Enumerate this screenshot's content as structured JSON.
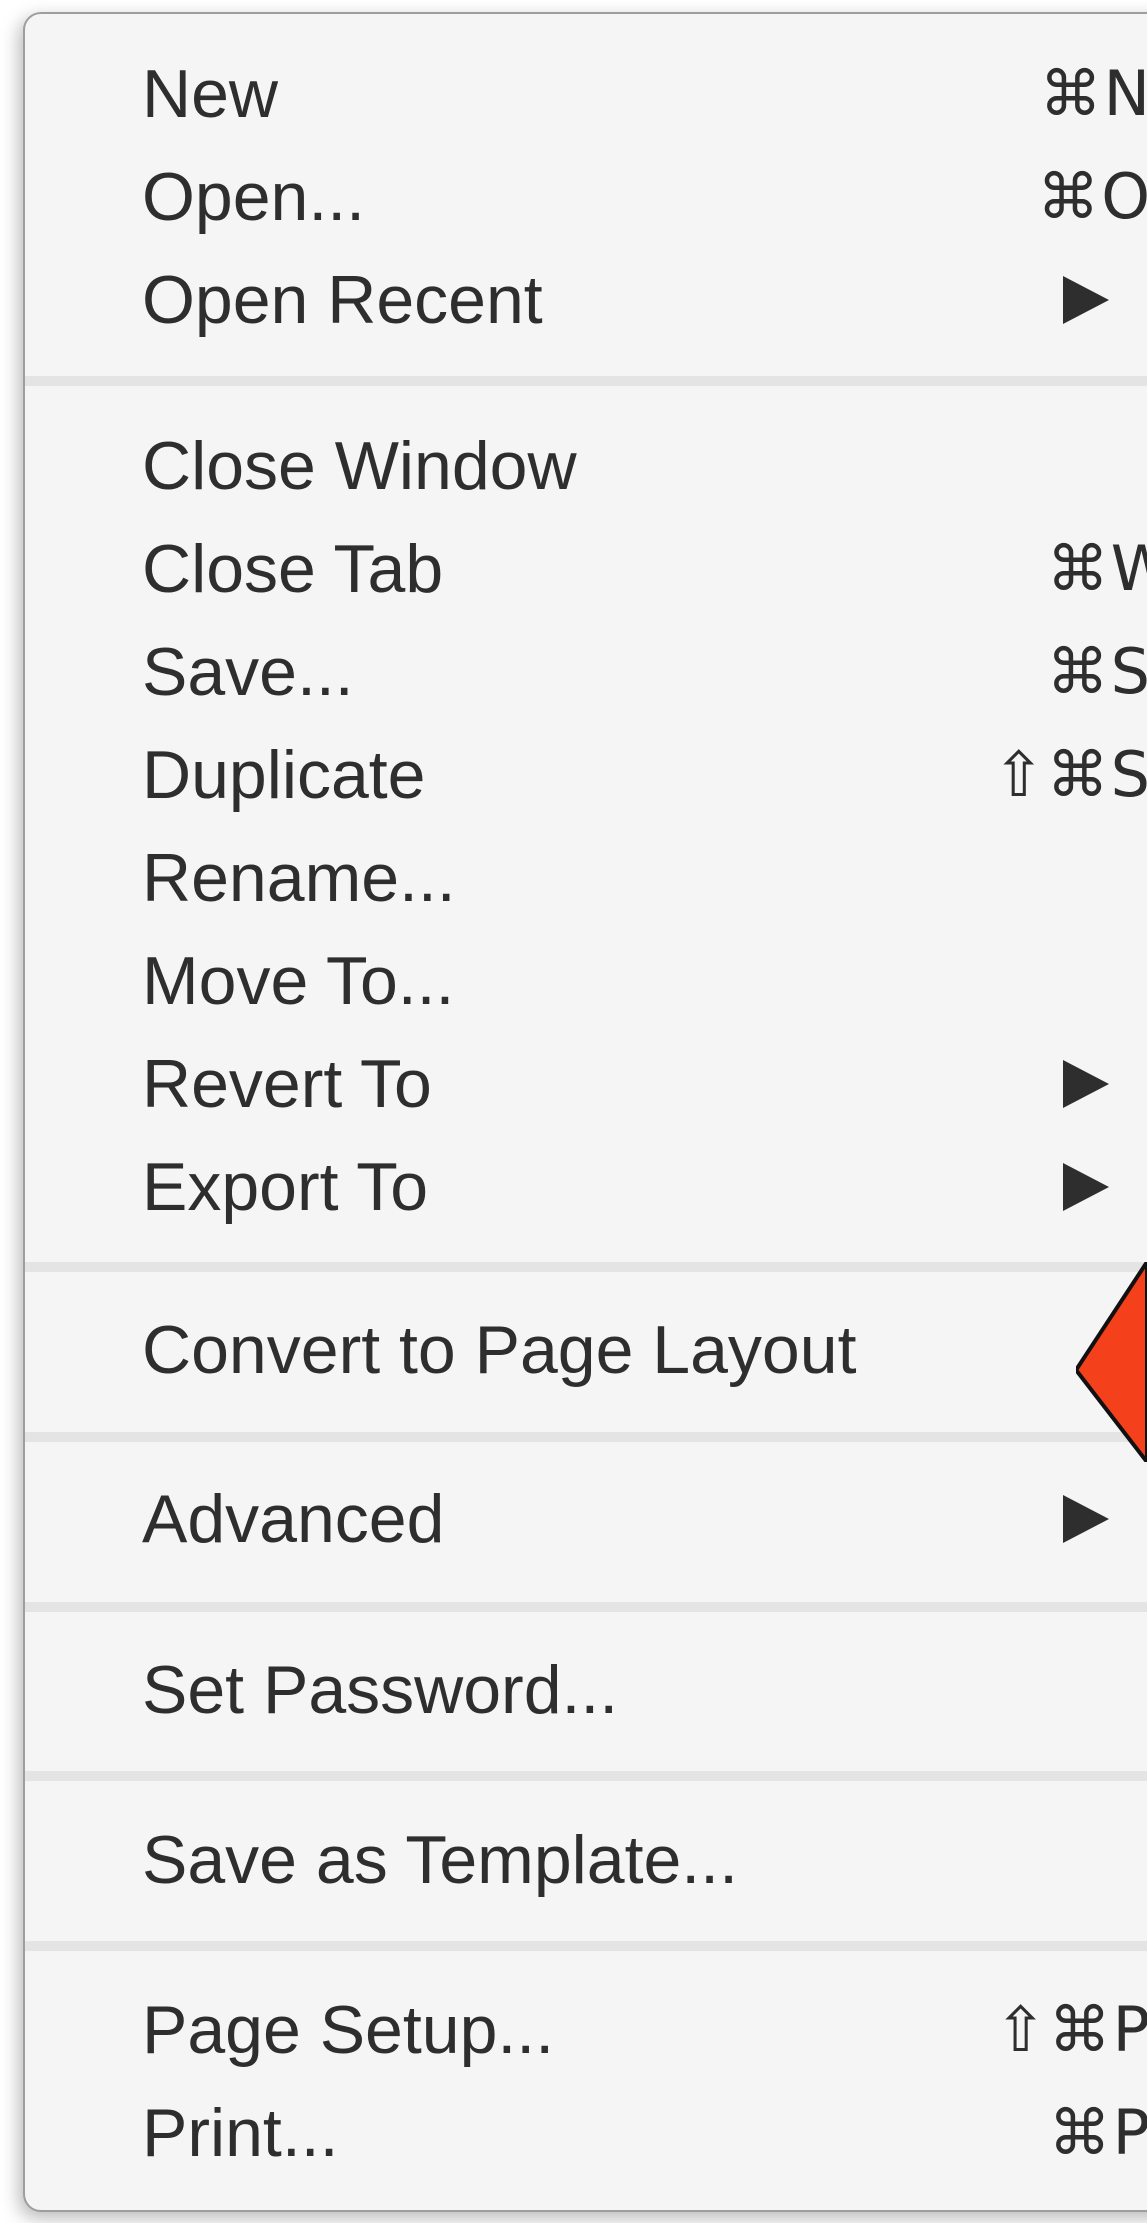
{
  "menu": {
    "groups": [
      [
        {
          "label": "New",
          "shortcut": "⌘N"
        },
        {
          "label": "Open...",
          "shortcut": "⌘O"
        },
        {
          "label": "Open Recent",
          "submenu": true
        }
      ],
      [
        {
          "label": "Close Window"
        },
        {
          "label": "Close Tab",
          "shortcut": "⌘W"
        },
        {
          "label": "Save...",
          "shortcut": "⌘S"
        },
        {
          "label": "Duplicate",
          "shortcut": "⇧⌘S"
        },
        {
          "label": "Rename..."
        },
        {
          "label": "Move To..."
        },
        {
          "label": "Revert To",
          "submenu": true
        },
        {
          "label": "Export To",
          "submenu": true
        }
      ],
      [
        {
          "label": "Convert to Page Layout"
        }
      ],
      [
        {
          "label": "Advanced",
          "submenu": true
        }
      ],
      [
        {
          "label": "Set Password..."
        }
      ],
      [
        {
          "label": "Save as Template..."
        }
      ],
      [
        {
          "label": "Page Setup...",
          "shortcut": "⇧⌘P"
        },
        {
          "label": "Print...",
          "shortcut": "⌘P"
        }
      ]
    ]
  },
  "callout": {
    "color": "#f4401b",
    "target": "Convert to Page Layout"
  }
}
